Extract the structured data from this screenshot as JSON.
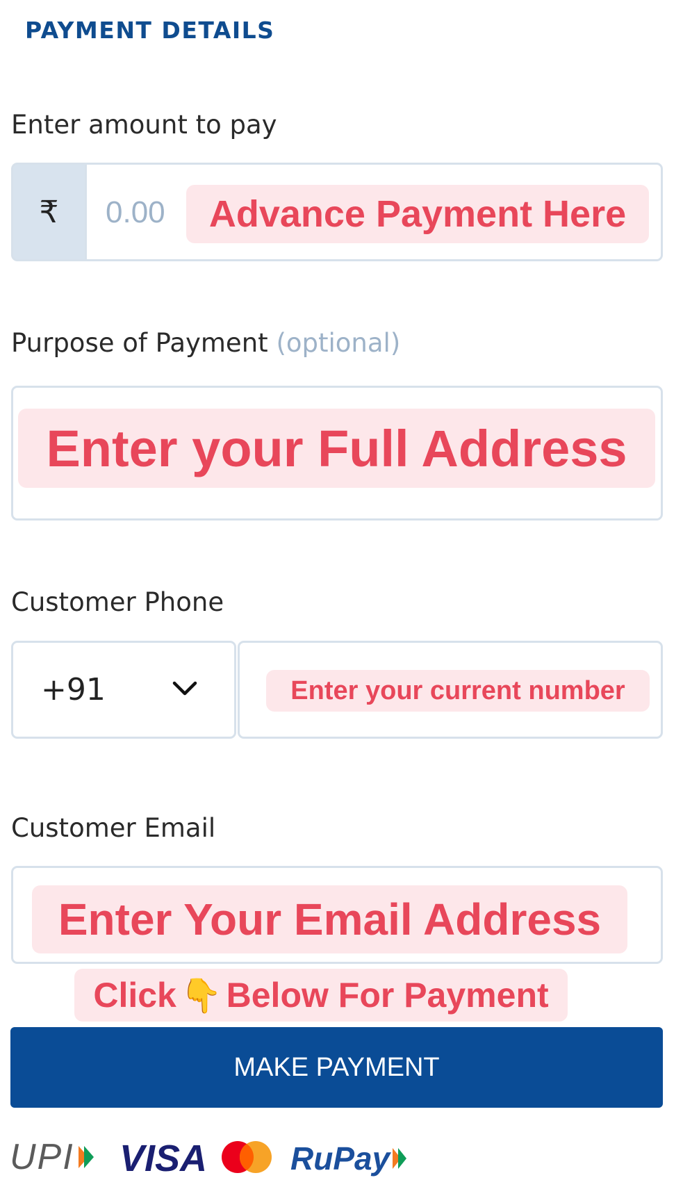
{
  "header": {
    "title": "PAYMENT DETAILS"
  },
  "amount": {
    "label": "Enter amount to pay",
    "currency_symbol": "₹",
    "placeholder": "0.00",
    "overlay": "Advance Payment Here"
  },
  "purpose": {
    "label": "Purpose of Payment",
    "optional_tag": "(optional)",
    "overlay": "Enter your Full Address"
  },
  "phone": {
    "label": "Customer Phone",
    "country_code": "+91",
    "overlay": "Enter your current number"
  },
  "email": {
    "label": "Customer Email",
    "overlay": "Enter Your Email Address"
  },
  "hint": {
    "text_before": "Click",
    "pointer_emoji": "👇",
    "text_after": "Below For Payment"
  },
  "submit": {
    "label": "MAKE PAYMENT"
  },
  "payment_logos": {
    "upi": "UPI",
    "visa": "VISA",
    "mastercard": "mastercard",
    "rupay": "RuPay"
  },
  "colors": {
    "accent": "#0a4c96",
    "title": "#0f4c8f",
    "overlay_text": "#e8475a",
    "overlay_bg": "#fde7ea",
    "border": "#d7e1eb",
    "placeholder": "#9db2c8"
  }
}
